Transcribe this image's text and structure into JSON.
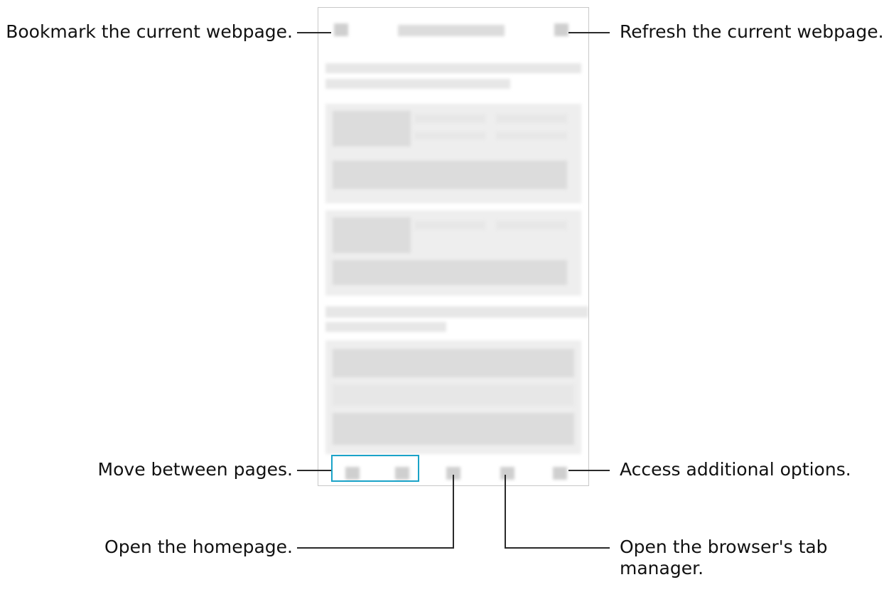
{
  "callouts": {
    "bookmark": "Bookmark the current webpage.",
    "refresh": "Refresh the current webpage.",
    "move_pages": "Move between pages.",
    "additional_options": "Access additional options.",
    "homepage": "Open the homepage.",
    "tab_manager": "Open the browser's tab manager."
  },
  "colors": {
    "highlight": "#1aa3c8",
    "line": "#2a2a2a"
  },
  "icons": [
    "bookmark-icon",
    "refresh-icon",
    "back-icon",
    "forward-icon",
    "home-icon",
    "tabs-icon",
    "more-options-icon"
  ]
}
